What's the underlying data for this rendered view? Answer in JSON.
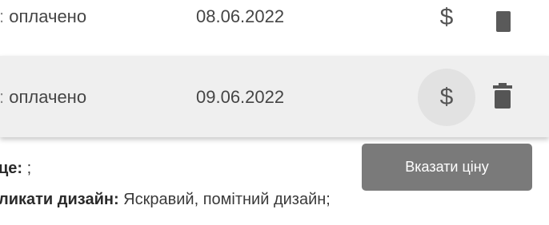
{
  "rows": [
    {
      "status": "оплачено",
      "date": "08.06.2022",
      "price_icon": "dollar-icon",
      "delete_icon": "trash-icon"
    },
    {
      "status": "оплачено",
      "date": "09.06.2022",
      "price_icon": "dollar-icon",
      "delete_icon": "trash-icon"
    }
  ],
  "dollar_symbol": "$",
  "tooltip": {
    "text": "Вказати ціну"
  },
  "details": {
    "line1_label": "це:",
    "line1_value": " ;",
    "line2_label": "ликати дизайн:",
    "line2_value": " Яскравий, помітний дизайн;"
  },
  "colors": {
    "hover_row": "#efefef",
    "tooltip_bg": "#7a7a7a",
    "icon": "#555555"
  }
}
